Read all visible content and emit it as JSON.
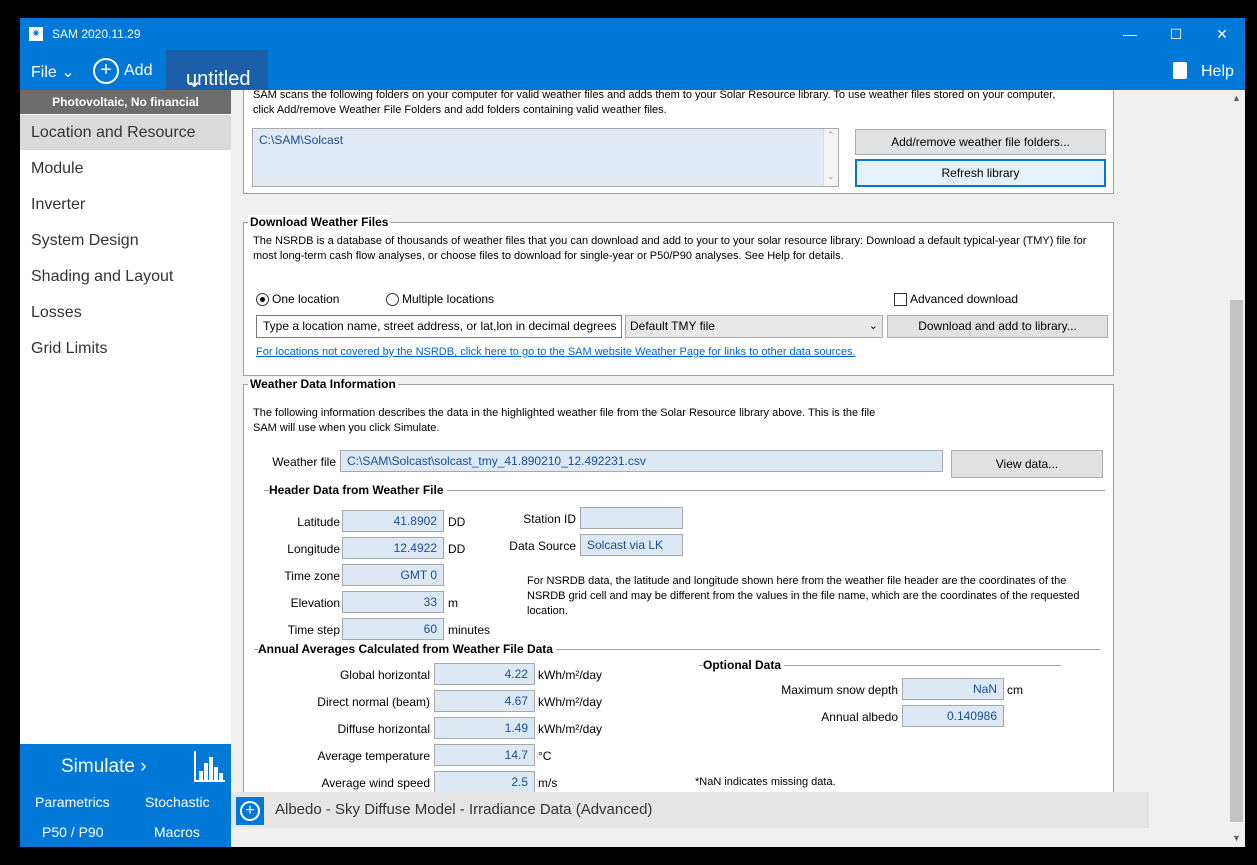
{
  "window": {
    "title": "SAM 2020.11.29",
    "icon": "sun-icon",
    "min_glyph": "—",
    "max_glyph": "☐",
    "close_glyph": "✕"
  },
  "menu": {
    "file": "File",
    "add": "Add",
    "case_tab": "untitled",
    "help": "Help"
  },
  "sidebar": {
    "config": "Photovoltaic, No financial",
    "items": [
      "Location and Resource",
      "Module",
      "Inverter",
      "System Design",
      "Shading and Layout",
      "Losses",
      "Grid Limits"
    ],
    "active": "Location and Resource",
    "simulate": "Simulate",
    "parametrics": "Parametrics",
    "stochastic": "Stochastic",
    "p50": "P50 / P90",
    "macros": "Macros"
  },
  "library": {
    "intro": "SAM scans the following folders on your computer for valid weather files and adds them to your Solar Resource library. To use weather files stored on your computer, click Add/remove Weather File Folders and add folders containing valid weather files.",
    "folder": "C:\\SAM\\Solcast",
    "add_remove": "Add/remove weather file folders...",
    "refresh": "Refresh library"
  },
  "download": {
    "title": "Download Weather Files",
    "intro": "The NSRDB is a database of thousands of weather files that you can download and add to your to your solar resource library: Download a default typical-year (TMY) file for most long-term cash flow analyses, or choose files to download for single-year or P50/P90 analyses. See Help for details.",
    "one_location": "One location",
    "multiple_locations": "Multiple locations",
    "advanced": "Advanced download",
    "location_placeholder": "Type a location name, street address, or lat,lon in decimal degrees",
    "file_type": "Default TMY file",
    "download_btn": "Download and add to library...",
    "link": "For locations not covered by the NSRDB, click here to go to the SAM website Weather Page for links to other data sources."
  },
  "info": {
    "title": "Weather Data Information",
    "intro_line1": "The following information describes the data in the highlighted weather file from the Solar Resource library above. This is the file",
    "intro_line2": "SAM will use when you click Simulate.",
    "weather_file_label": "Weather file",
    "weather_file": "C:\\SAM\\Solcast\\solcast_tmy_41.890210_12.492231.csv",
    "view_data": "View data...",
    "header_title": "Header Data from Weather File",
    "latitude_label": "Latitude",
    "latitude": "41.8902",
    "longitude_label": "Longitude",
    "longitude": "12.4922",
    "dd": "DD",
    "timezone_label": "Time zone",
    "timezone": "GMT 0",
    "elevation_label": "Elevation",
    "elevation": "33",
    "m": "m",
    "timestep_label": "Time step",
    "timestep": "60",
    "minutes": "minutes",
    "station_label": "Station ID",
    "station": "",
    "source_label": "Data Source",
    "source": "Solcast via LK",
    "nsrdb_note": "For NSRDB data, the latitude and longitude shown here from the weather file header are the coordinates of the NSRDB grid cell and may be different from the values in the file name, which are the coordinates of the requested location.",
    "annual_title": "Annual Averages Calculated from Weather File  Data",
    "ghi_label": "Global horizontal",
    "ghi": "4.22",
    "dni_label": "Direct normal (beam)",
    "dni": "4.67",
    "dhi_label": "Diffuse horizontal",
    "dhi": "1.49",
    "kwh_unit": "kWh/m²/day",
    "temp_label": "Average temperature",
    "temp": "14.7",
    "c_unit": "°C",
    "wind_label": "Average wind speed",
    "wind": "2.5",
    "ms_unit": "m/s",
    "optional_title": "Optional Data",
    "snow_label": "Maximum snow depth",
    "snow": "NaN",
    "cm": "cm",
    "albedo_label": "Annual albedo",
    "albedo": "0.140986",
    "nan_note": "*NaN indicates missing data."
  },
  "bottom": {
    "label": "Albedo - Sky Diffuse Model - Irradiance Data (Advanced)"
  },
  "colors": {
    "accent": "#0078d7",
    "field_bg": "#dde8f5",
    "field_text": "#1a4d99"
  }
}
